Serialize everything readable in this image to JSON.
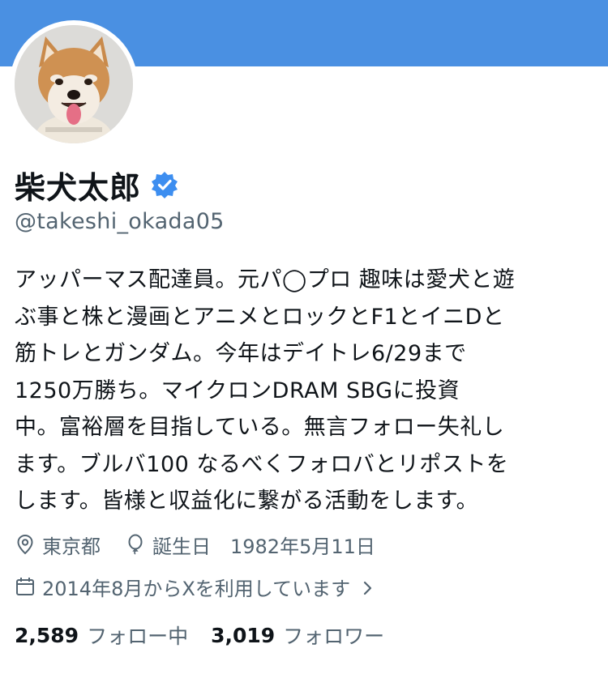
{
  "colors": {
    "banner": "#4a90e2",
    "verified_badge": "#3d8ef0",
    "secondary_text": "#536471",
    "primary_text": "#0f1419"
  },
  "profile": {
    "avatar_icon": "shiba-dog-avatar",
    "display_name": "柴犬太郎",
    "verified_icon": "verified-badge-icon",
    "handle": "@takeshi_okada05",
    "bio_lines": [
      "アッパーマス配達員。元パ◯プロ 趣味は愛犬と遊",
      "ぶ事と株と漫画とアニメとロックとF1とイニDと",
      "筋トレとガンダム。今年はデイトレ6/29まで",
      "1250万勝ち。マイクロンDRAM SBGに投資",
      "中。富裕層を目指している。無言フォロー失礼し",
      "ます。ブルバ100 なるべくフォロバとリポストを",
      "します。皆様と収益化に繋がる活動をします。"
    ]
  },
  "meta": {
    "location": "東京都",
    "birthday_label": "誕生日",
    "birthday_value": "1982年5月11日",
    "joined": "2014年8月からXを利用しています"
  },
  "stats": {
    "following_count": "2,589",
    "following_label": "フォロー中",
    "followers_count": "3,019",
    "followers_label": "フォロワー"
  }
}
